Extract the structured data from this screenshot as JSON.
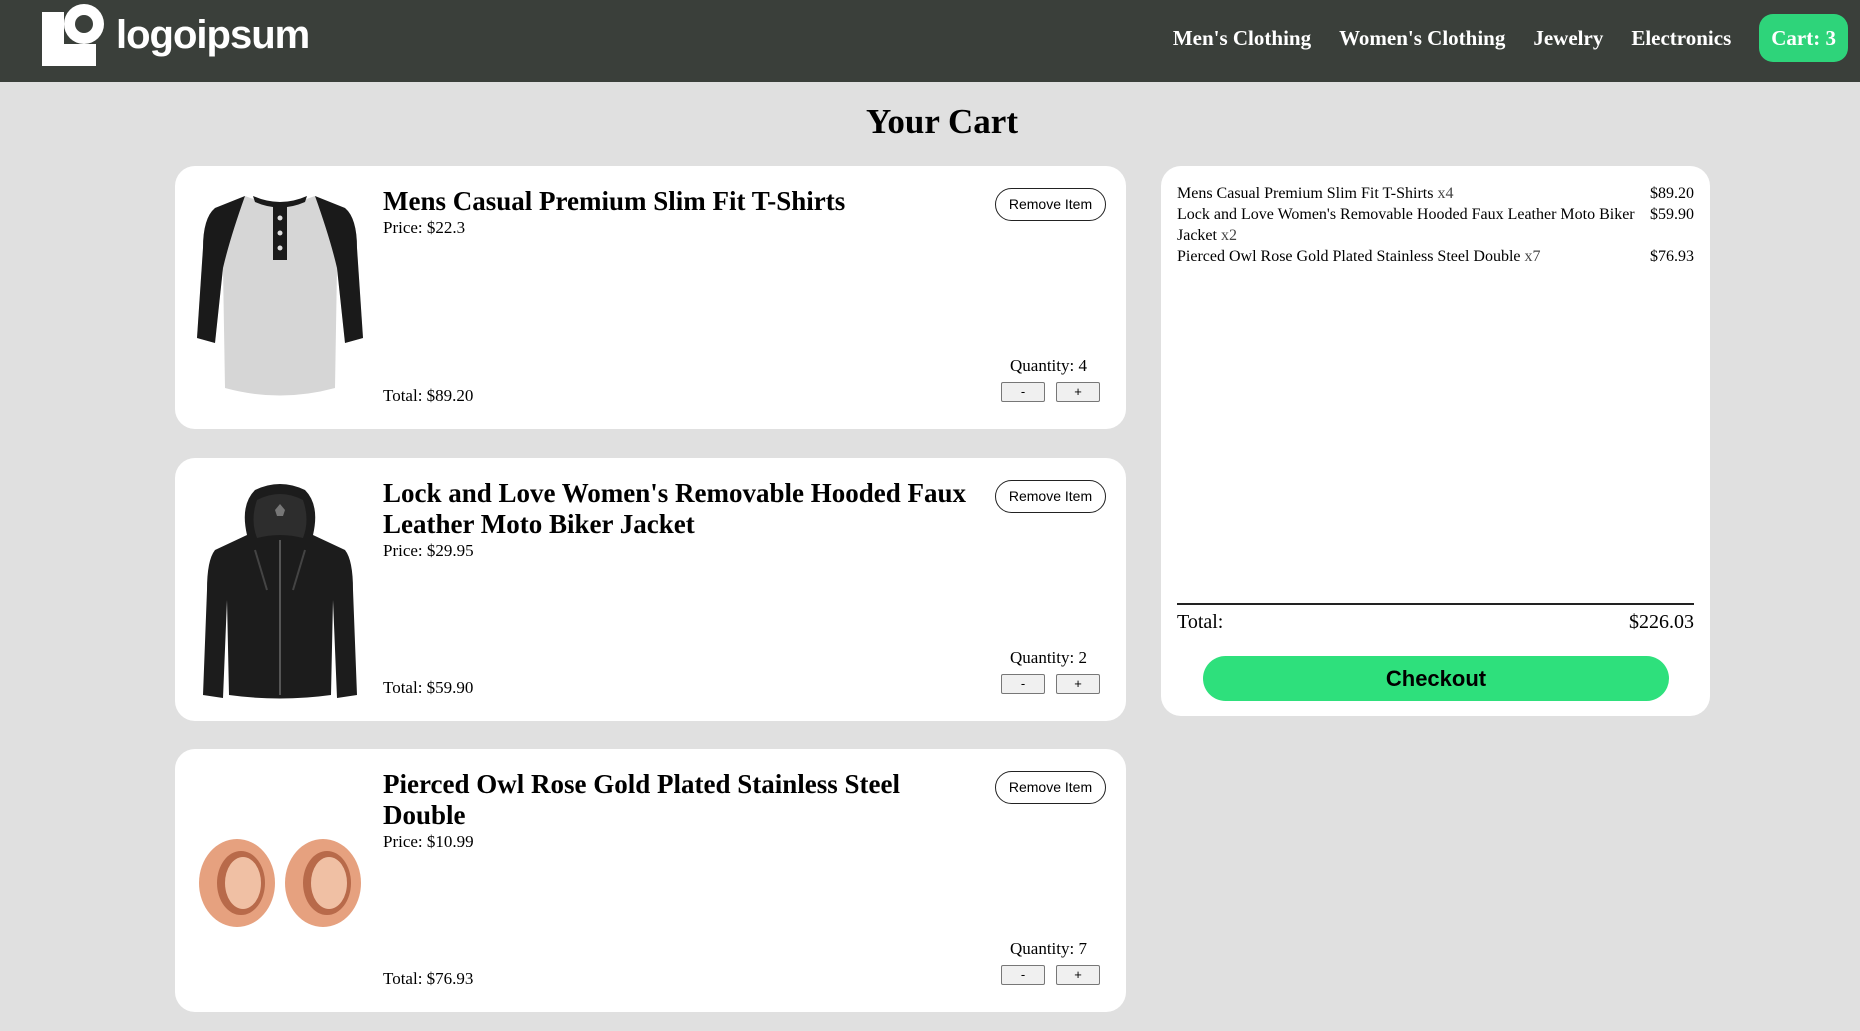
{
  "header": {
    "logo_text": "logoipsum",
    "nav": [
      "Men's Clothing",
      "Women's Clothing",
      "Jewelry",
      "Electronics"
    ],
    "cart_label": "Cart: 3"
  },
  "page_title": "Your Cart",
  "items": [
    {
      "name": "Mens Casual Premium Slim Fit T-Shirts",
      "price": "Price: $22.3",
      "remove_label": "Remove Item",
      "quantity": "Quantity: 4",
      "minus_label": "-",
      "plus_label": "+",
      "total": "Total: $89.20",
      "image_icon": "raglan-tshirt-icon"
    },
    {
      "name": "Lock and Love Women's Removable Hooded Faux Leather Moto Biker Jacket",
      "price": "Price: $29.95",
      "remove_label": "Remove Item",
      "quantity": "Quantity: 2",
      "minus_label": "-",
      "plus_label": "+",
      "total": "Total: $59.90",
      "image_icon": "hooded-jacket-icon"
    },
    {
      "name": "Pierced Owl Rose Gold Plated Stainless Steel Double",
      "price": "Price: $10.99",
      "remove_label": "Remove Item",
      "quantity": "Quantity: 7",
      "minus_label": "-",
      "plus_label": "+",
      "total": "Total: $76.93",
      "image_icon": "rose-gold-plugs-icon"
    }
  ],
  "summary": {
    "lines": [
      {
        "name": "Mens Casual Premium Slim Fit T-Shirts",
        "qty": "x4",
        "price": "$89.20"
      },
      {
        "name": "Lock and Love Women's Removable Hooded Faux Leather Moto Biker Jacket",
        "qty": "x2",
        "price": "$59.90"
      },
      {
        "name": "Pierced Owl Rose Gold Plated Stainless Steel Double",
        "qty": "x7",
        "price": "$76.93"
      }
    ],
    "total_label": "Total:",
    "total_value": "$226.03",
    "checkout_label": "Checkout"
  },
  "colors": {
    "header_bg": "#3a3f3a",
    "page_bg": "#e0e0e0",
    "accent_green": "#2ed47a",
    "checkout_green": "#2ee07c"
  }
}
